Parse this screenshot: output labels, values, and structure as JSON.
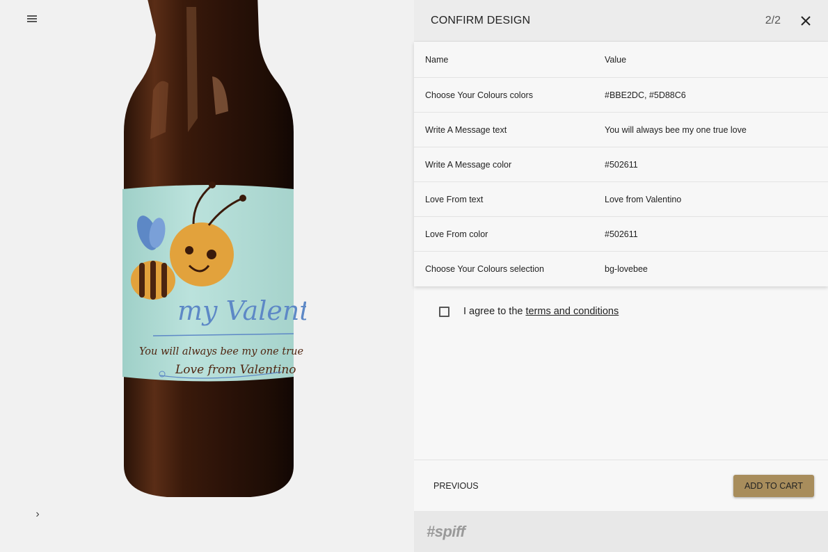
{
  "panel": {
    "title": "CONFIRM DESIGN",
    "step": "2/2"
  },
  "table": {
    "header": {
      "name": "Name",
      "value": "Value"
    },
    "rows": [
      {
        "name": "Choose Your Colours colors",
        "value": "#BBE2DC, #5D88C6"
      },
      {
        "name": "Write A Message text",
        "value": "You will always bee my one true love"
      },
      {
        "name": "Write A Message color",
        "value": "#502611"
      },
      {
        "name": "Love From text",
        "value": "Love from Valentino"
      },
      {
        "name": "Love From color",
        "value": "#502611"
      },
      {
        "name": "Choose Your Colours selection",
        "value": "bg-lovebee"
      }
    ]
  },
  "agree": {
    "prefix": "I agree to the",
    "link": "terms and conditions"
  },
  "footer": {
    "previous": "PREVIOUS",
    "add_to_cart": "ADD TO CART"
  },
  "brand": "#spiff",
  "label": {
    "headline": "my Valentine",
    "message": "You will always bee my one true love",
    "from": "Love from Valentino"
  },
  "colors": {
    "label_bg": "#BBE2DC",
    "accent": "#5D88C6",
    "text": "#502611",
    "cart_button": "#A88D5C"
  },
  "icons": {
    "menu": "menu-icon",
    "expand": "chevron-right-icon",
    "close": "close-icon",
    "checkbox": "checkbox-unchecked-icon"
  }
}
